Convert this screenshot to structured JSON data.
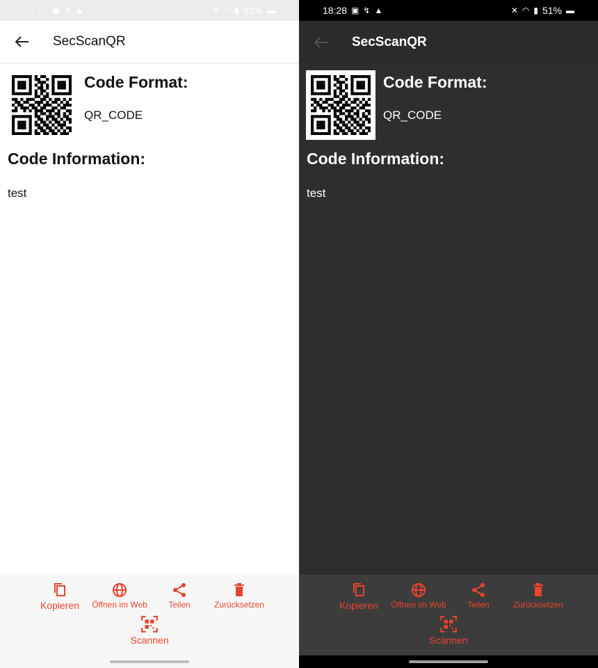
{
  "screens": [
    {
      "theme": "light",
      "status": {
        "time": "18:29",
        "battery": "51%"
      },
      "app_title": "SecScanQR",
      "format_heading": "Code Format:",
      "format_value": "QR_CODE",
      "info_heading": "Code Information:",
      "info_value": "test",
      "actions": [
        "Kopieren",
        "Öffnen im Web",
        "Teilen",
        "Zurücksetzen"
      ],
      "scan_label": "Scannen"
    },
    {
      "theme": "dark",
      "status": {
        "time": "18:28",
        "battery": "51%"
      },
      "app_title": "SecScanQR",
      "format_heading": "Code Format:",
      "format_value": "QR_CODE",
      "info_heading": "Code Information:",
      "info_value": "test",
      "actions": [
        "Kopieren",
        "Öffnen im Web",
        "Teilen",
        "Zurücksetzen"
      ],
      "scan_label": "Scannen"
    }
  ],
  "colors": {
    "accent": "#e8442e",
    "dark_surface": "#2e2e2e",
    "dark_appbar": "#2b2b2b",
    "dark_bottombar": "#3c3c3c"
  },
  "icons": [
    "back-arrow-icon",
    "copy-icon",
    "globe-icon",
    "share-icon",
    "trash-icon",
    "qr-scan-icon"
  ]
}
